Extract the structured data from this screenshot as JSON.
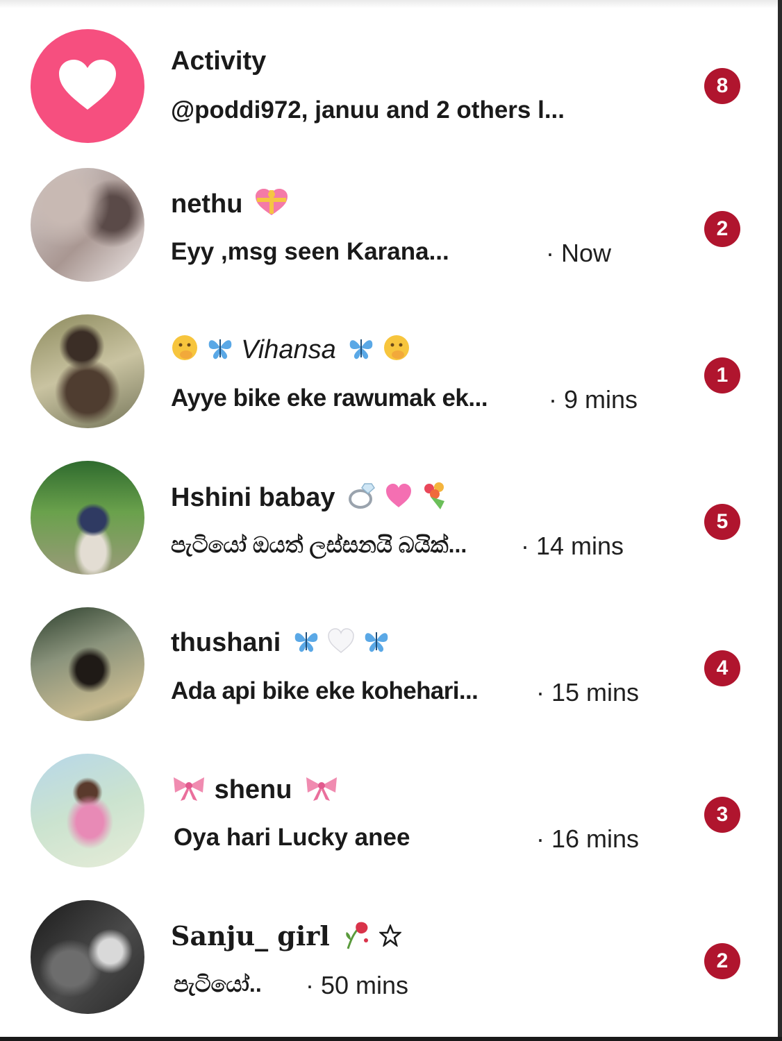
{
  "activity": {
    "title": "Activity",
    "subtitle": "@poddi972, januu and 2 others l...",
    "badge": "8",
    "icon": "heart-icon",
    "accent": "#f64f7f"
  },
  "chats": [
    {
      "name": "nethu",
      "decor_after": "gift-heart-icon",
      "preview": "Eyy ,msg seen Karana...",
      "time": "· Now",
      "badge": "2"
    },
    {
      "name": "Vihansa",
      "decor_before": "peek-face-icon butterfly-icon",
      "decor_after": "butterfly-icon peek-face-icon",
      "preview": "Ayye bike eke rawumak ek...",
      "time": "· 9 mins",
      "badge": "1"
    },
    {
      "name": "Hshini babay",
      "decor_after": "ring-icon pink-heart-icon bouquet-icon",
      "preview": "පැටියෝ ඔයත් ලස්සනයි බයික්...",
      "time": "· 14 mins",
      "badge": "5"
    },
    {
      "name": "thushani",
      "decor_after": "butterfly-icon white-heart-icon butterfly-icon",
      "preview": "Ada api bike eke kohehari...",
      "time": "· 15 mins",
      "badge": "4"
    },
    {
      "name": "shenu",
      "decor_before": "ribbon-icon",
      "decor_after": "ribbon-icon",
      "preview": "Oya hari Lucky anee",
      "time": "· 16 mins",
      "badge": "3"
    },
    {
      "name": "Sanju_ girl",
      "decor_after": "wilted-rose-icon star-icon",
      "preview": "පැටියෝ..",
      "time": "· 50 mins",
      "badge": "2"
    }
  ],
  "colors": {
    "badge": "#b0152e",
    "butterfly": "#5aa8e6",
    "ribbon": "#f08bb0"
  }
}
